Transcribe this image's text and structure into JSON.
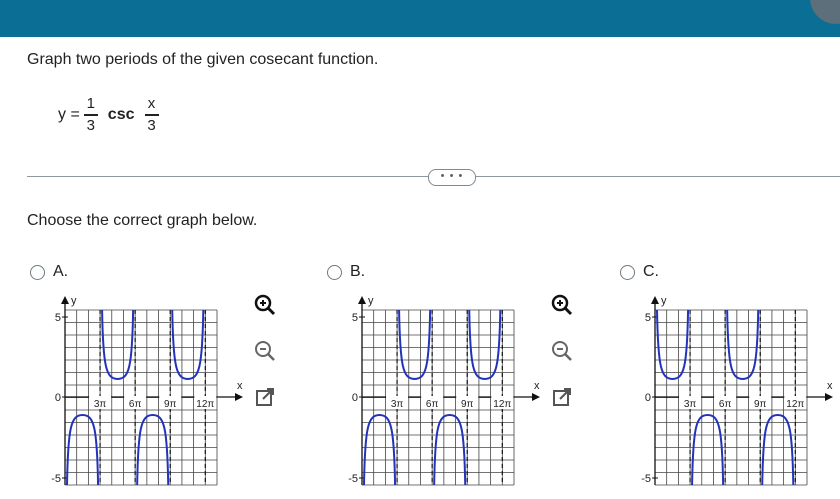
{
  "question": {
    "title": "Graph two periods of the given cosecant function.",
    "equation": {
      "lhs": "y =",
      "coef_num": "1",
      "coef_den": "3",
      "func": "csc",
      "arg_num": "x",
      "arg_den": "3"
    }
  },
  "more_button_label": "• • •",
  "choose_prompt": "Choose the correct graph below.",
  "options": [
    {
      "letter": "A.",
      "selected": false,
      "y_labels": [
        "5",
        "0",
        "-5"
      ],
      "x_axis_label": "x",
      "y_axis_label": "y",
      "x_tick_labels": [
        "3π",
        "6π",
        "9π",
        "12π"
      ],
      "branch_direction": "down-first"
    },
    {
      "letter": "B.",
      "selected": false,
      "y_labels": [
        "5",
        "0",
        "-5"
      ],
      "x_axis_label": "x",
      "y_axis_label": "y",
      "x_tick_labels": [
        "3π",
        "6π",
        "9π",
        "12π"
      ],
      "branch_direction": "down-first"
    },
    {
      "letter": "C.",
      "selected": false,
      "y_labels": [
        "5",
        "0",
        "-5"
      ],
      "x_axis_label": "x",
      "y_axis_label": "y",
      "x_tick_labels": [
        "3π",
        "6π",
        "9π",
        "12π"
      ],
      "branch_direction": "up-first"
    }
  ],
  "tools": [
    "zoom-in-icon",
    "zoom-out-icon",
    "popout-icon"
  ],
  "colors": {
    "topbar": "#0b6e95",
    "curve": "#2233bb",
    "grid": "#333333",
    "radio": "#6c7a84"
  }
}
